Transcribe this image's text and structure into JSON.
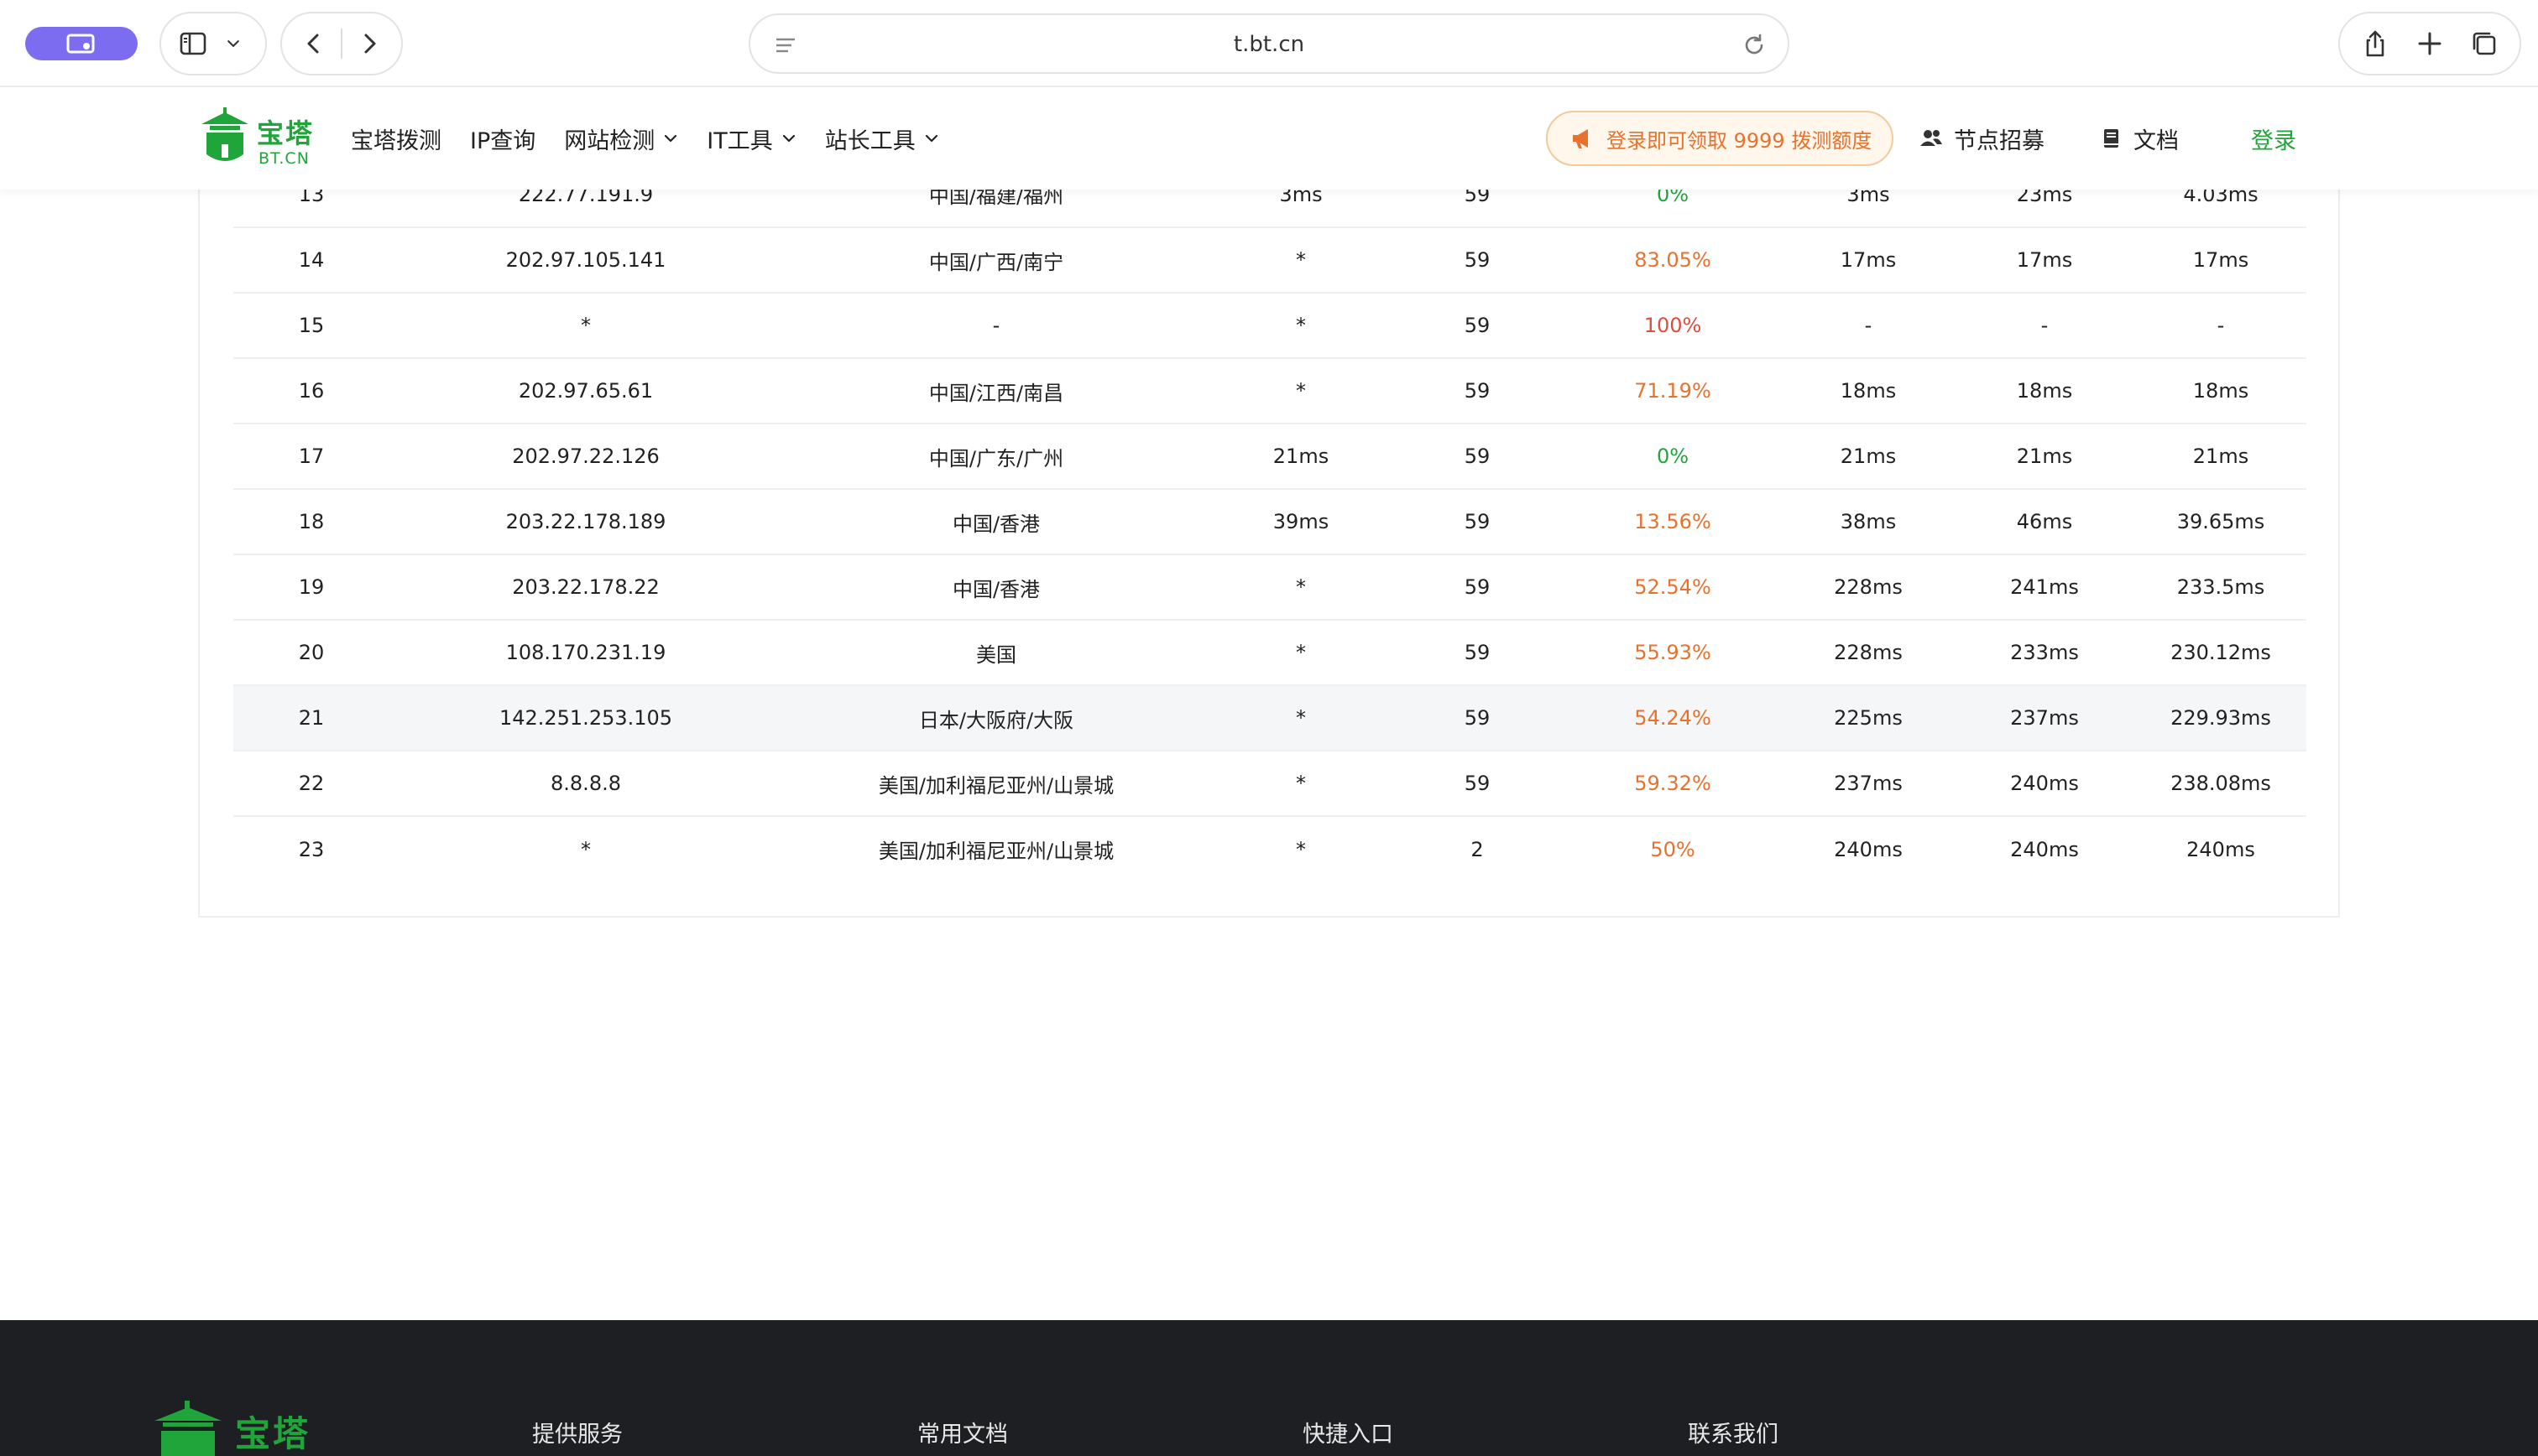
{
  "browser": {
    "url": "t.bt.cn",
    "icons": {
      "profile": "profile-icon",
      "sidebar": "sidebar-icon",
      "back": "back-icon",
      "forward": "forward-icon",
      "reader": "reader-icon",
      "reload": "reload-icon",
      "share": "share-icon",
      "new_tab": "plus-icon",
      "tabs": "tabs-icon"
    }
  },
  "header": {
    "logo": {
      "cn": "宝塔",
      "en": "BT.CN"
    },
    "nav": [
      "宝塔拨测",
      "IP查询",
      "网站检测",
      "IT工具",
      "站长工具"
    ],
    "promo": "登录即可领取 9999 拨测额度",
    "recruit": "节点招募",
    "docs": "文档",
    "login": "登录"
  },
  "colors": {
    "brand_green": "#20a53a",
    "promo_orange": "#e8712c",
    "loss_red": "#e04b3a",
    "profile_purple": "#7b6cf0",
    "footer_bg": "#1d1f22"
  },
  "table": {
    "rows": [
      {
        "hop": "13",
        "ip": "222.77.191.9",
        "location": "中国/福建/福州",
        "time": "3ms",
        "sent": "59",
        "loss": "0%",
        "loss_level": "green",
        "min": "3ms",
        "max": "23ms",
        "avg": "4.03ms"
      },
      {
        "hop": "14",
        "ip": "202.97.105.141",
        "location": "中国/广西/南宁",
        "time": "*",
        "sent": "59",
        "loss": "83.05%",
        "loss_level": "orange",
        "min": "17ms",
        "max": "17ms",
        "avg": "17ms"
      },
      {
        "hop": "15",
        "ip": "*",
        "location": "-",
        "time": "*",
        "sent": "59",
        "loss": "100%",
        "loss_level": "red",
        "min": "-",
        "max": "-",
        "avg": "-"
      },
      {
        "hop": "16",
        "ip": "202.97.65.61",
        "location": "中国/江西/南昌",
        "time": "*",
        "sent": "59",
        "loss": "71.19%",
        "loss_level": "orange",
        "min": "18ms",
        "max": "18ms",
        "avg": "18ms"
      },
      {
        "hop": "17",
        "ip": "202.97.22.126",
        "location": "中国/广东/广州",
        "time": "21ms",
        "sent": "59",
        "loss": "0%",
        "loss_level": "green",
        "min": "21ms",
        "max": "21ms",
        "avg": "21ms"
      },
      {
        "hop": "18",
        "ip": "203.22.178.189",
        "location": "中国/香港",
        "time": "39ms",
        "sent": "59",
        "loss": "13.56%",
        "loss_level": "orange",
        "min": "38ms",
        "max": "46ms",
        "avg": "39.65ms"
      },
      {
        "hop": "19",
        "ip": "203.22.178.22",
        "location": "中国/香港",
        "time": "*",
        "sent": "59",
        "loss": "52.54%",
        "loss_level": "orange",
        "min": "228ms",
        "max": "241ms",
        "avg": "233.5ms"
      },
      {
        "hop": "20",
        "ip": "108.170.231.19",
        "location": "美国",
        "time": "*",
        "sent": "59",
        "loss": "55.93%",
        "loss_level": "orange",
        "min": "228ms",
        "max": "233ms",
        "avg": "230.12ms"
      },
      {
        "hop": "21",
        "ip": "142.251.253.105",
        "location": "日本/大阪府/大阪",
        "time": "*",
        "sent": "59",
        "loss": "54.24%",
        "loss_level": "orange",
        "min": "225ms",
        "max": "237ms",
        "avg": "229.93ms"
      },
      {
        "hop": "22",
        "ip": "8.8.8.8",
        "location": "美国/加利福尼亚州/山景城",
        "time": "*",
        "sent": "59",
        "loss": "59.32%",
        "loss_level": "orange",
        "min": "237ms",
        "max": "240ms",
        "avg": "238.08ms"
      },
      {
        "hop": "23",
        "ip": "*",
        "location": "美国/加利福尼亚州/山景城",
        "time": "*",
        "sent": "2",
        "loss": "50%",
        "loss_level": "orange",
        "min": "240ms",
        "max": "240ms",
        "avg": "240ms"
      }
    ]
  },
  "footer": {
    "logo_text": "宝塔",
    "columns": [
      "提供服务",
      "常用文档",
      "快捷入口",
      "联系我们"
    ]
  }
}
